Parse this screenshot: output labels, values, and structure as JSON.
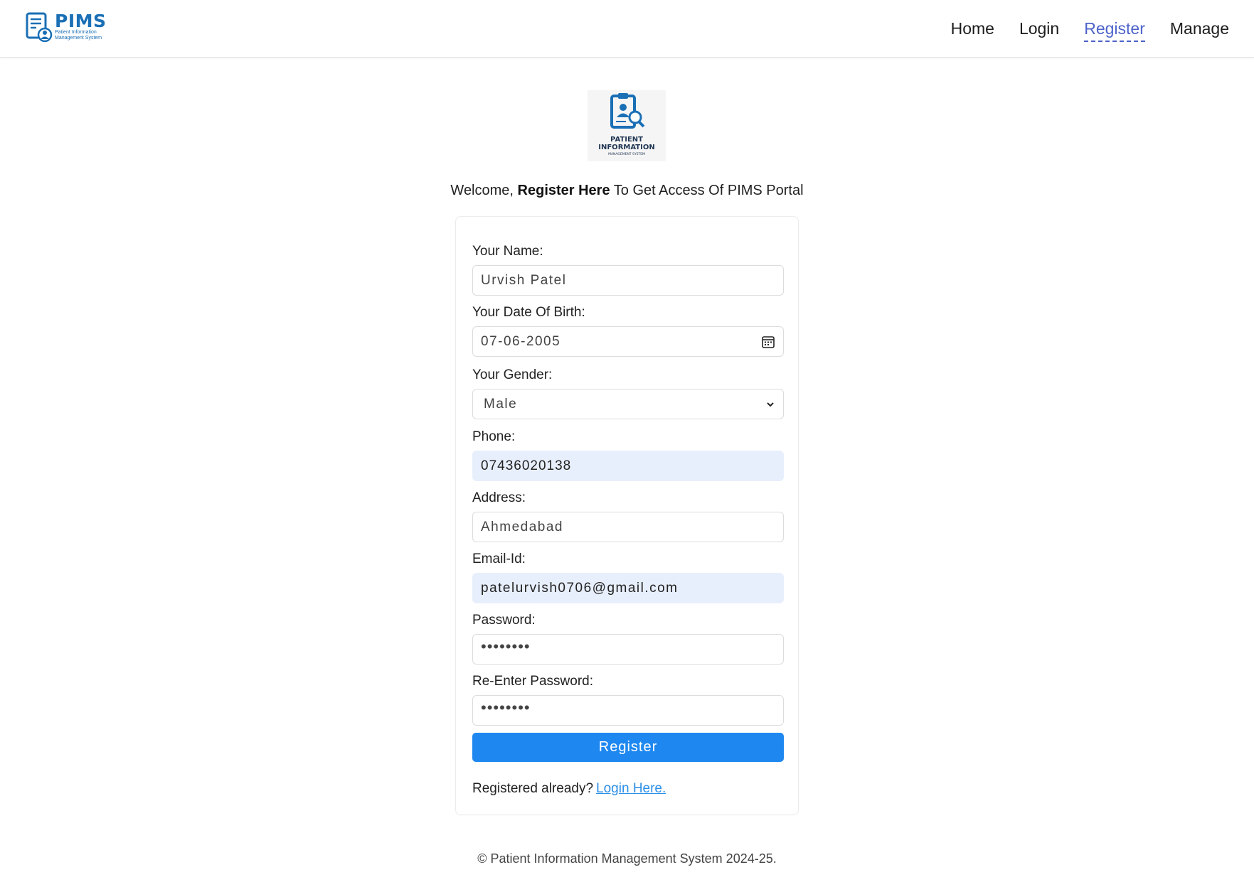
{
  "brand": {
    "name": "PIMS",
    "subtitle_line1": "Patient Information",
    "subtitle_line2": "Management System"
  },
  "nav": [
    {
      "label": "Home",
      "active": false
    },
    {
      "label": "Login",
      "active": false
    },
    {
      "label": "Register",
      "active": true
    },
    {
      "label": "Manage",
      "active": false
    }
  ],
  "logo": {
    "line1": "PATIENT",
    "line2": "INFORMATION",
    "line3": "MANAGEMENT SYSTEM"
  },
  "welcome": {
    "prefix": "Welcome,",
    "bold": "Register Here",
    "suffix": "To Get Access Of PIMS Portal"
  },
  "form": {
    "name": {
      "label": "Your Name:",
      "value": "Urvish Patel"
    },
    "dob": {
      "label": "Your Date Of Birth:",
      "value": "07-06-2005"
    },
    "gender": {
      "label": "Your Gender:",
      "value": "Male"
    },
    "phone": {
      "label": "Phone:",
      "value": "07436020138"
    },
    "address": {
      "label": "Address:",
      "value": "Ahmedabad"
    },
    "email": {
      "label": "Email-Id:",
      "value": "patelurvish0706@gmail.com"
    },
    "password": {
      "label": "Password:",
      "value": "••••••••"
    },
    "repassword": {
      "label": "Re-Enter Password:",
      "value": "••••••••"
    },
    "submit_label": "Register",
    "already_text": "Registered already?",
    "login_link": "Login Here."
  },
  "footer": "© Patient Information Management System 2024-25.",
  "colors": {
    "brand_blue": "#1a6fb5",
    "nav_active": "#4d63c9",
    "button": "#1e88f0",
    "link": "#2b8fe6",
    "autofill_bg": "#e8effc"
  }
}
